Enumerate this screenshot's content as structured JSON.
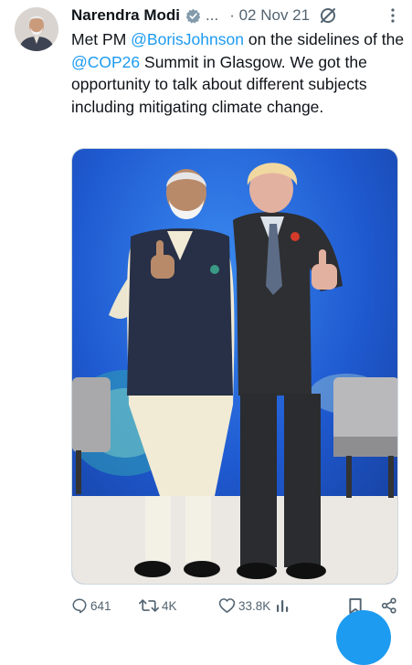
{
  "tweet": {
    "author": "Narendra Modi",
    "handle": "...",
    "date": "· 02 Nov 21",
    "text_parts": {
      "t1": "Met PM ",
      "mention": "@BorisJohnson",
      "t2": " on the sidelines of the ",
      "hashtag": "@COP26",
      "t3": " Summit in Glasgow. We got the opportunity to talk about different subjects including mitigating climate change."
    }
  },
  "actions": {
    "replies": "641",
    "retweets": "4K",
    "likes": "33.8K"
  },
  "icons": {
    "verified": "verified-badge-icon",
    "grok": "grok-icon",
    "more": "more-options-icon",
    "reply": "reply-icon",
    "retweet": "retweet-icon",
    "like": "heart-icon",
    "views": "views-icon",
    "bookmark": "bookmark-icon",
    "share": "share-icon"
  },
  "colors": {
    "link": "#1d9bf0",
    "secondary_text": "#536471",
    "stage_background": "#1f5ad1"
  }
}
